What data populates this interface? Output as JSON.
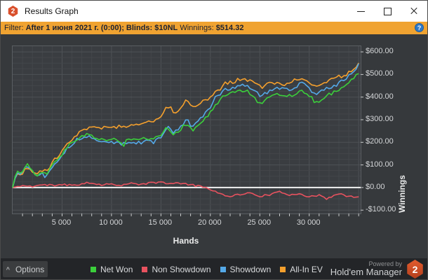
{
  "window": {
    "title": "Results Graph",
    "badge": "2"
  },
  "icons": {
    "titlebar_badge": "hm2-hexagon-logo",
    "minimize": "window-minimize",
    "maximize": "window-maximize",
    "close": "window-close",
    "help": "question-mark-circle",
    "options_caret": "caret-up"
  },
  "filter_bar": {
    "segments": [
      {
        "text": "Filter: ",
        "bold": false
      },
      {
        "text": "After 1 июня 2021 г. (0:00); Blinds: $10NL",
        "bold": true
      },
      {
        "text": " Winnings: ",
        "bold": false
      },
      {
        "text": "$514.32",
        "bold": true
      }
    ],
    "help_icon": "?"
  },
  "chart_data": {
    "type": "line",
    "title": "",
    "xlabel": "Hands",
    "ylabel": "Winnings",
    "xlim": [
      0,
      35200
    ],
    "ylim": [
      -115,
      625
    ],
    "x_minor_step": 1000,
    "x_major_step": 5000,
    "y_minor_step": 25,
    "y_major_step": 100,
    "grid": true,
    "legend_position": "bottom",
    "zero_line_value": 0,
    "x_ticks": [
      {
        "value": 5000,
        "label": "5 000"
      },
      {
        "value": 10000,
        "label": "10 000"
      },
      {
        "value": 15000,
        "label": "15 000"
      },
      {
        "value": 20000,
        "label": "20 000"
      },
      {
        "value": 25000,
        "label": "25 000"
      },
      {
        "value": 30000,
        "label": "30 000"
      }
    ],
    "y_ticks": [
      {
        "value": 600,
        "label": "$600.00"
      },
      {
        "value": 500,
        "label": "$500.00"
      },
      {
        "value": 400,
        "label": "$400.00"
      },
      {
        "value": 300,
        "label": "$300.00"
      },
      {
        "value": 200,
        "label": "$200.00"
      },
      {
        "value": 100,
        "label": "$100.00"
      },
      {
        "value": 0,
        "label": "$0.00"
      },
      {
        "value": -100,
        "label": "-$100.00"
      }
    ],
    "series": [
      {
        "name": "Net Won",
        "color": "#3bcf3b",
        "points": [
          [
            0,
            0
          ],
          [
            400,
            75
          ],
          [
            900,
            60
          ],
          [
            1400,
            105
          ],
          [
            1900,
            85
          ],
          [
            2400,
            50
          ],
          [
            2900,
            75
          ],
          [
            3400,
            60
          ],
          [
            4200,
            110
          ],
          [
            5000,
            150
          ],
          [
            5700,
            185
          ],
          [
            6500,
            215
          ],
          [
            7300,
            235
          ],
          [
            8000,
            225
          ],
          [
            8700,
            205
          ],
          [
            9500,
            215
          ],
          [
            10300,
            210
          ],
          [
            11000,
            195
          ],
          [
            11800,
            210
          ],
          [
            12600,
            205
          ],
          [
            13400,
            215
          ],
          [
            14200,
            210
          ],
          [
            15000,
            230
          ],
          [
            15600,
            265
          ],
          [
            16200,
            235
          ],
          [
            17000,
            260
          ],
          [
            17600,
            285
          ],
          [
            18200,
            250
          ],
          [
            19000,
            285
          ],
          [
            19800,
            320
          ],
          [
            20600,
            365
          ],
          [
            21400,
            405
          ],
          [
            22200,
            415
          ],
          [
            23000,
            430
          ],
          [
            23800,
            425
          ],
          [
            24600,
            385
          ],
          [
            25200,
            365
          ],
          [
            26000,
            400
          ],
          [
            26800,
            415
          ],
          [
            27600,
            400
          ],
          [
            28400,
            410
          ],
          [
            29200,
            425
          ],
          [
            30000,
            405
          ],
          [
            30700,
            375
          ],
          [
            31400,
            395
          ],
          [
            32200,
            415
          ],
          [
            33000,
            435
          ],
          [
            33800,
            460
          ],
          [
            34400,
            480
          ],
          [
            35000,
            510
          ]
        ]
      },
      {
        "name": "Non Showdown",
        "color": "#e8525f",
        "points": [
          [
            0,
            0
          ],
          [
            1000,
            8
          ],
          [
            2000,
            5
          ],
          [
            3000,
            12
          ],
          [
            4000,
            8
          ],
          [
            5000,
            14
          ],
          [
            6000,
            10
          ],
          [
            7000,
            16
          ],
          [
            8000,
            20
          ],
          [
            9000,
            12
          ],
          [
            10000,
            16
          ],
          [
            11000,
            10
          ],
          [
            12000,
            18
          ],
          [
            13000,
            14
          ],
          [
            14000,
            20
          ],
          [
            15000,
            24
          ],
          [
            16000,
            16
          ],
          [
            17000,
            20
          ],
          [
            18000,
            12
          ],
          [
            19000,
            8
          ],
          [
            19600,
            0
          ],
          [
            20200,
            -15
          ],
          [
            21000,
            -28
          ],
          [
            22000,
            -38
          ],
          [
            23000,
            -30
          ],
          [
            24000,
            -25
          ],
          [
            25000,
            -38
          ],
          [
            26000,
            -32
          ],
          [
            27000,
            -20
          ],
          [
            28000,
            -32
          ],
          [
            29000,
            -26
          ],
          [
            30000,
            -42
          ],
          [
            31000,
            -35
          ],
          [
            32000,
            -45
          ],
          [
            33000,
            -28
          ],
          [
            34000,
            -40
          ],
          [
            35000,
            -42
          ]
        ]
      },
      {
        "name": "Showdown",
        "color": "#54a9e8",
        "points": [
          [
            0,
            0
          ],
          [
            400,
            70
          ],
          [
            900,
            55
          ],
          [
            1400,
            100
          ],
          [
            1900,
            80
          ],
          [
            2400,
            45
          ],
          [
            2900,
            70
          ],
          [
            3400,
            55
          ],
          [
            4200,
            105
          ],
          [
            5000,
            145
          ],
          [
            5700,
            180
          ],
          [
            6500,
            210
          ],
          [
            7300,
            230
          ],
          [
            8000,
            220
          ],
          [
            8700,
            200
          ],
          [
            9500,
            205
          ],
          [
            10300,
            200
          ],
          [
            11000,
            190
          ],
          [
            11800,
            200
          ],
          [
            12600,
            195
          ],
          [
            13400,
            205
          ],
          [
            14200,
            200
          ],
          [
            15000,
            225
          ],
          [
            15600,
            270
          ],
          [
            16200,
            240
          ],
          [
            17000,
            270
          ],
          [
            17600,
            300
          ],
          [
            18200,
            265
          ],
          [
            19000,
            305
          ],
          [
            19800,
            345
          ],
          [
            20600,
            395
          ],
          [
            21400,
            430
          ],
          [
            22200,
            440
          ],
          [
            23000,
            455
          ],
          [
            23800,
            450
          ],
          [
            24600,
            420
          ],
          [
            25200,
            405
          ],
          [
            26000,
            430
          ],
          [
            26800,
            445
          ],
          [
            27600,
            430
          ],
          [
            28400,
            440
          ],
          [
            29200,
            460
          ],
          [
            30000,
            435
          ],
          [
            30700,
            415
          ],
          [
            31400,
            430
          ],
          [
            32200,
            445
          ],
          [
            33000,
            460
          ],
          [
            33800,
            485
          ],
          [
            34400,
            510
          ],
          [
            35000,
            545
          ]
        ]
      },
      {
        "name": "All-In EV",
        "color": "#f5a02d",
        "points": [
          [
            0,
            0
          ],
          [
            400,
            65
          ],
          [
            900,
            55
          ],
          [
            1400,
            90
          ],
          [
            1900,
            75
          ],
          [
            2400,
            55
          ],
          [
            2900,
            80
          ],
          [
            3400,
            70
          ],
          [
            4200,
            120
          ],
          [
            5000,
            160
          ],
          [
            5700,
            200
          ],
          [
            6500,
            235
          ],
          [
            7300,
            255
          ],
          [
            8000,
            270
          ],
          [
            8700,
            260
          ],
          [
            9500,
            275
          ],
          [
            10300,
            270
          ],
          [
            11000,
            260
          ],
          [
            11800,
            275
          ],
          [
            12600,
            280
          ],
          [
            13400,
            285
          ],
          [
            14200,
            295
          ],
          [
            15000,
            320
          ],
          [
            15600,
            360
          ],
          [
            16200,
            330
          ],
          [
            17000,
            350
          ],
          [
            17600,
            385
          ],
          [
            18200,
            360
          ],
          [
            19000,
            375
          ],
          [
            19800,
            395
          ],
          [
            20600,
            430
          ],
          [
            21400,
            460
          ],
          [
            22200,
            465
          ],
          [
            23000,
            480
          ],
          [
            23800,
            475
          ],
          [
            24600,
            455
          ],
          [
            25200,
            445
          ],
          [
            26000,
            465
          ],
          [
            26800,
            460
          ],
          [
            27600,
            450
          ],
          [
            28400,
            465
          ],
          [
            29200,
            480
          ],
          [
            30000,
            465
          ],
          [
            30700,
            450
          ],
          [
            31400,
            465
          ],
          [
            32200,
            475
          ],
          [
            33000,
            485
          ],
          [
            33800,
            500
          ],
          [
            34400,
            520
          ],
          [
            35000,
            550
          ]
        ]
      }
    ]
  },
  "footer": {
    "options_label": "Options",
    "options_caret": "^",
    "powered_by": "Powered by",
    "brand": "Hold'em Manager",
    "brand_badge": "2"
  },
  "colors": {
    "filter_bar_bg": "#f0a331",
    "filter_text": "#1c2130",
    "help_icon_bg": "#2e79c7",
    "panel_bg": "#36393c",
    "plot_bg": "#3a3d41",
    "grid_minor": "#43464a",
    "grid_major": "#4e5256",
    "plot_frame": "#5a5e62",
    "axis_text": "#d4d6d8",
    "zero_line": "#f2f2f2",
    "footer_bg": "#232528",
    "titlebar_bg": "#ffffff",
    "brand_badge_color": "#d9502c"
  }
}
